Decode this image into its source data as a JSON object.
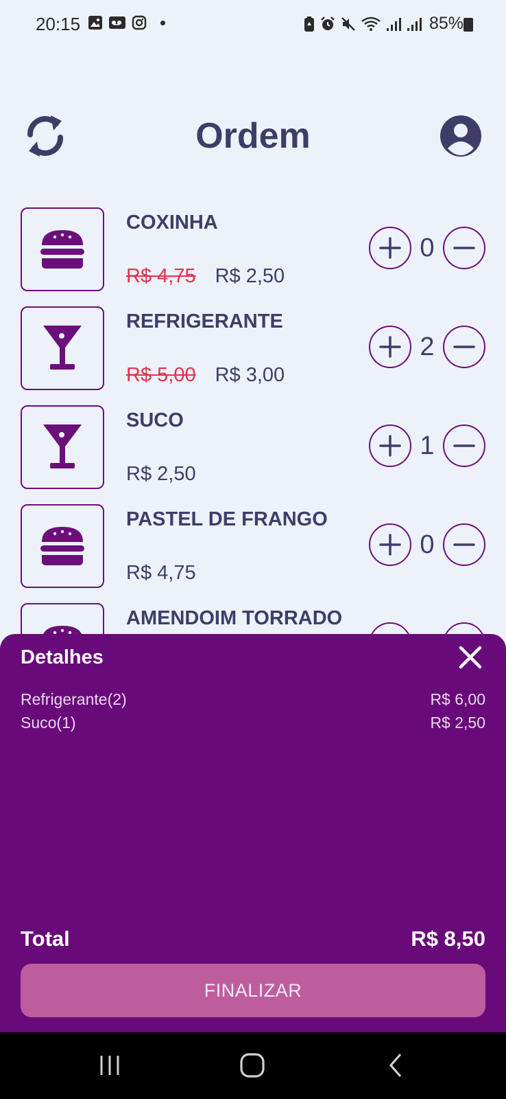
{
  "status_bar": {
    "time": "20:15",
    "battery": "85%"
  },
  "header": {
    "title": "Ordem"
  },
  "products": [
    {
      "name": "COXINHA",
      "old_price": "R$ 4,75",
      "price": "R$ 2,50",
      "qty": "0",
      "icon": "hamburger-icon"
    },
    {
      "name": "REFRIGERANTE",
      "old_price": "R$ 5,00",
      "price": "R$ 3,00",
      "qty": "2",
      "icon": "cocktail-icon"
    },
    {
      "name": "SUCO",
      "old_price": "",
      "price": "R$ 2,50",
      "qty": "1",
      "icon": "cocktail-icon"
    },
    {
      "name": "PASTEL DE FRANGO",
      "old_price": "",
      "price": "R$ 4,75",
      "qty": "0",
      "icon": "hamburger-icon"
    },
    {
      "name": "AMENDOIM TORRADO",
      "icon": "hamburger-icon"
    }
  ],
  "details": {
    "title": "Detalhes",
    "items": [
      {
        "label": "Refrigerante(2)",
        "value": "R$ 6,00"
      },
      {
        "label": "Suco(1)",
        "value": "R$ 2,50"
      }
    ],
    "total_label": "Total",
    "total_value": "R$ 8,50",
    "finish_label": "FINALIZAR"
  },
  "colors": {
    "background": "#edf1f9",
    "accent_purple": "#6b0f7a",
    "sheet_purple": "#690a7a",
    "button_pink": "#bd5d9e",
    "old_price_red": "#e0344c",
    "text_dark": "#3f3d68"
  }
}
